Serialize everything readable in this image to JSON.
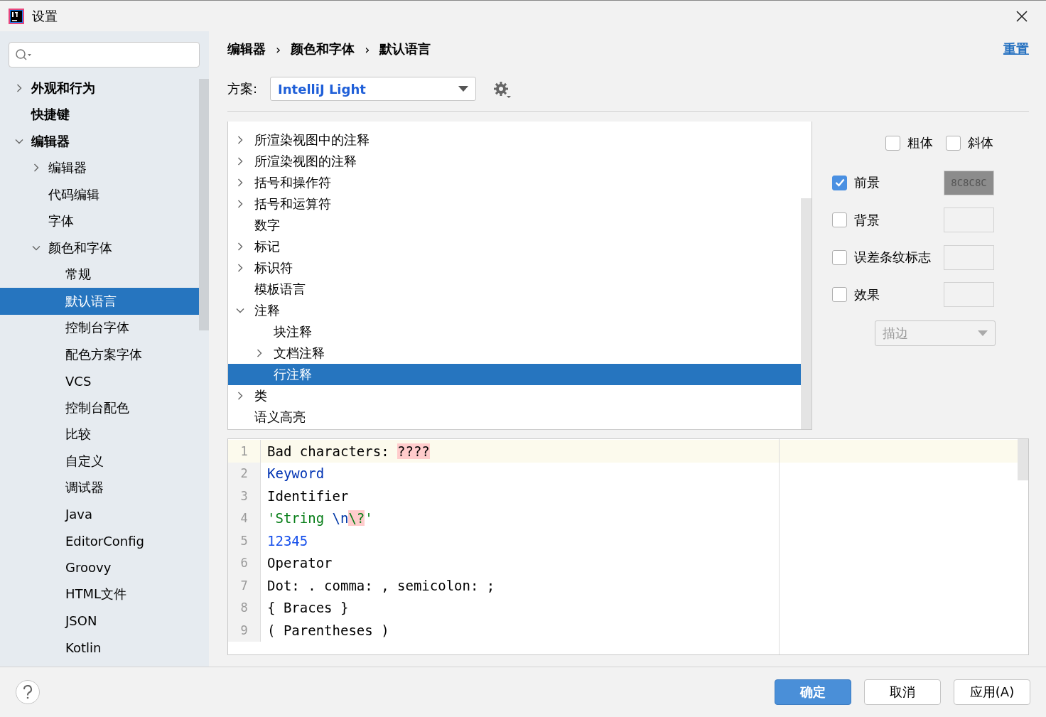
{
  "window": {
    "title": "设置"
  },
  "sidebar": {
    "items": [
      {
        "label": "外观和行为",
        "kind": "folder",
        "expanded": false,
        "selected": false,
        "bold": true
      },
      {
        "label": "快捷键",
        "kind": "leaf",
        "selected": false,
        "bold": true
      },
      {
        "label": "编辑器",
        "kind": "folder",
        "expanded": true,
        "selected": false,
        "bold": true,
        "children": [
          {
            "label": "编辑器",
            "kind": "folder",
            "expanded": false,
            "selected": false
          },
          {
            "label": "代码编辑",
            "kind": "leaf",
            "selected": false
          },
          {
            "label": "字体",
            "kind": "leaf",
            "selected": false
          },
          {
            "label": "颜色和字体",
            "kind": "folder",
            "expanded": true,
            "selected": false,
            "children": [
              {
                "label": "常规",
                "kind": "leaf",
                "selected": false
              },
              {
                "label": "默认语言",
                "kind": "leaf",
                "selected": true
              },
              {
                "label": "控制台字体",
                "kind": "leaf",
                "selected": false
              },
              {
                "label": "配色方案字体",
                "kind": "leaf",
                "selected": false
              },
              {
                "label": "VCS",
                "kind": "leaf",
                "selected": false
              },
              {
                "label": "控制台配色",
                "kind": "leaf",
                "selected": false
              },
              {
                "label": "比较",
                "kind": "leaf",
                "selected": false
              },
              {
                "label": "自定义",
                "kind": "leaf",
                "selected": false
              },
              {
                "label": "调试器",
                "kind": "leaf",
                "selected": false
              },
              {
                "label": "Java",
                "kind": "leaf",
                "selected": false
              },
              {
                "label": "EditorConfig",
                "kind": "leaf",
                "selected": false
              },
              {
                "label": "Groovy",
                "kind": "leaf",
                "selected": false
              },
              {
                "label": "HTML文件",
                "kind": "leaf",
                "selected": false
              },
              {
                "label": "JSON",
                "kind": "leaf",
                "selected": false
              },
              {
                "label": "Kotlin",
                "kind": "leaf",
                "selected": false
              }
            ]
          }
        ]
      }
    ]
  },
  "breadcrumb": [
    "编辑器",
    "颜色和字体",
    "默认语言"
  ],
  "separator": "›",
  "reset_link": "重置",
  "scheme": {
    "label": "方案:",
    "value": "IntelliJ Light"
  },
  "tree": {
    "items": [
      {
        "label": "所渲染视图中的注释",
        "kind": "folder",
        "expanded": false,
        "selected": false
      },
      {
        "label": "所渲染视图的注释",
        "kind": "folder",
        "expanded": false,
        "selected": false
      },
      {
        "label": "括号和操作符",
        "kind": "folder",
        "expanded": false,
        "selected": false
      },
      {
        "label": "括号和运算符",
        "kind": "folder",
        "expanded": false,
        "selected": false
      },
      {
        "label": "数字",
        "kind": "leaf",
        "selected": false
      },
      {
        "label": "标记",
        "kind": "folder",
        "expanded": false,
        "selected": false
      },
      {
        "label": "标识符",
        "kind": "folder",
        "expanded": false,
        "selected": false
      },
      {
        "label": "模板语言",
        "kind": "leaf",
        "selected": false
      },
      {
        "label": "注释",
        "kind": "folder",
        "expanded": true,
        "selected": false,
        "children": [
          {
            "label": "块注释",
            "kind": "leaf",
            "selected": false
          },
          {
            "label": "文档注释",
            "kind": "folder",
            "expanded": false,
            "selected": false
          },
          {
            "label": "行注释",
            "kind": "leaf",
            "selected": true
          }
        ]
      },
      {
        "label": "类",
        "kind": "folder",
        "expanded": false,
        "selected": false
      },
      {
        "label": "语义高亮",
        "kind": "leaf",
        "selected": false
      }
    ]
  },
  "style_options": [
    {
      "label": "粗体",
      "checked": false
    },
    {
      "label": "斜体",
      "checked": false
    }
  ],
  "color_options": [
    {
      "label": "前景",
      "checked": true,
      "value": "8C8C8C",
      "color": "#8c8c8c"
    },
    {
      "label": "背景",
      "checked": false
    },
    {
      "label": "误差条纹标志",
      "checked": false
    },
    {
      "label": "效果",
      "checked": false
    }
  ],
  "effect_dropdown": {
    "value": "描边",
    "disabled": true
  },
  "preview": {
    "lines": [
      {
        "number": "1",
        "current": true,
        "tokens": [
          {
            "text": "Bad characters: ",
            "kind": "plain"
          },
          {
            "text": "????",
            "kind": "bad"
          }
        ]
      },
      {
        "number": "2",
        "current": false,
        "tokens": [
          {
            "text": "Keyword",
            "kind": "keyword"
          }
        ]
      },
      {
        "number": "3",
        "current": false,
        "tokens": [
          {
            "text": "Identifier",
            "kind": "plain"
          }
        ]
      },
      {
        "number": "4",
        "current": false,
        "tokens": [
          {
            "text": "'String ",
            "kind": "string"
          },
          {
            "text": "\\n",
            "kind": "escape"
          },
          {
            "text": "\\?",
            "kind": "bad-escape"
          },
          {
            "text": "'",
            "kind": "string"
          }
        ]
      },
      {
        "number": "5",
        "current": false,
        "tokens": [
          {
            "text": "12345",
            "kind": "number"
          }
        ]
      },
      {
        "number": "6",
        "current": false,
        "tokens": [
          {
            "text": "Operator",
            "kind": "plain"
          }
        ]
      },
      {
        "number": "7",
        "current": false,
        "tokens": [
          {
            "text": "Dot: . comma: , semicolon: ;",
            "kind": "plain"
          }
        ]
      },
      {
        "number": "8",
        "current": false,
        "tokens": [
          {
            "text": "{ Braces }",
            "kind": "plain"
          }
        ]
      },
      {
        "number": "9",
        "current": false,
        "tokens": [
          {
            "text": "( Parentheses )",
            "kind": "plain"
          }
        ]
      }
    ]
  },
  "buttons": [
    {
      "label": "确定",
      "primary": true
    },
    {
      "label": "取消",
      "primary": false
    },
    {
      "label": "应用(A)",
      "primary": false
    }
  ]
}
